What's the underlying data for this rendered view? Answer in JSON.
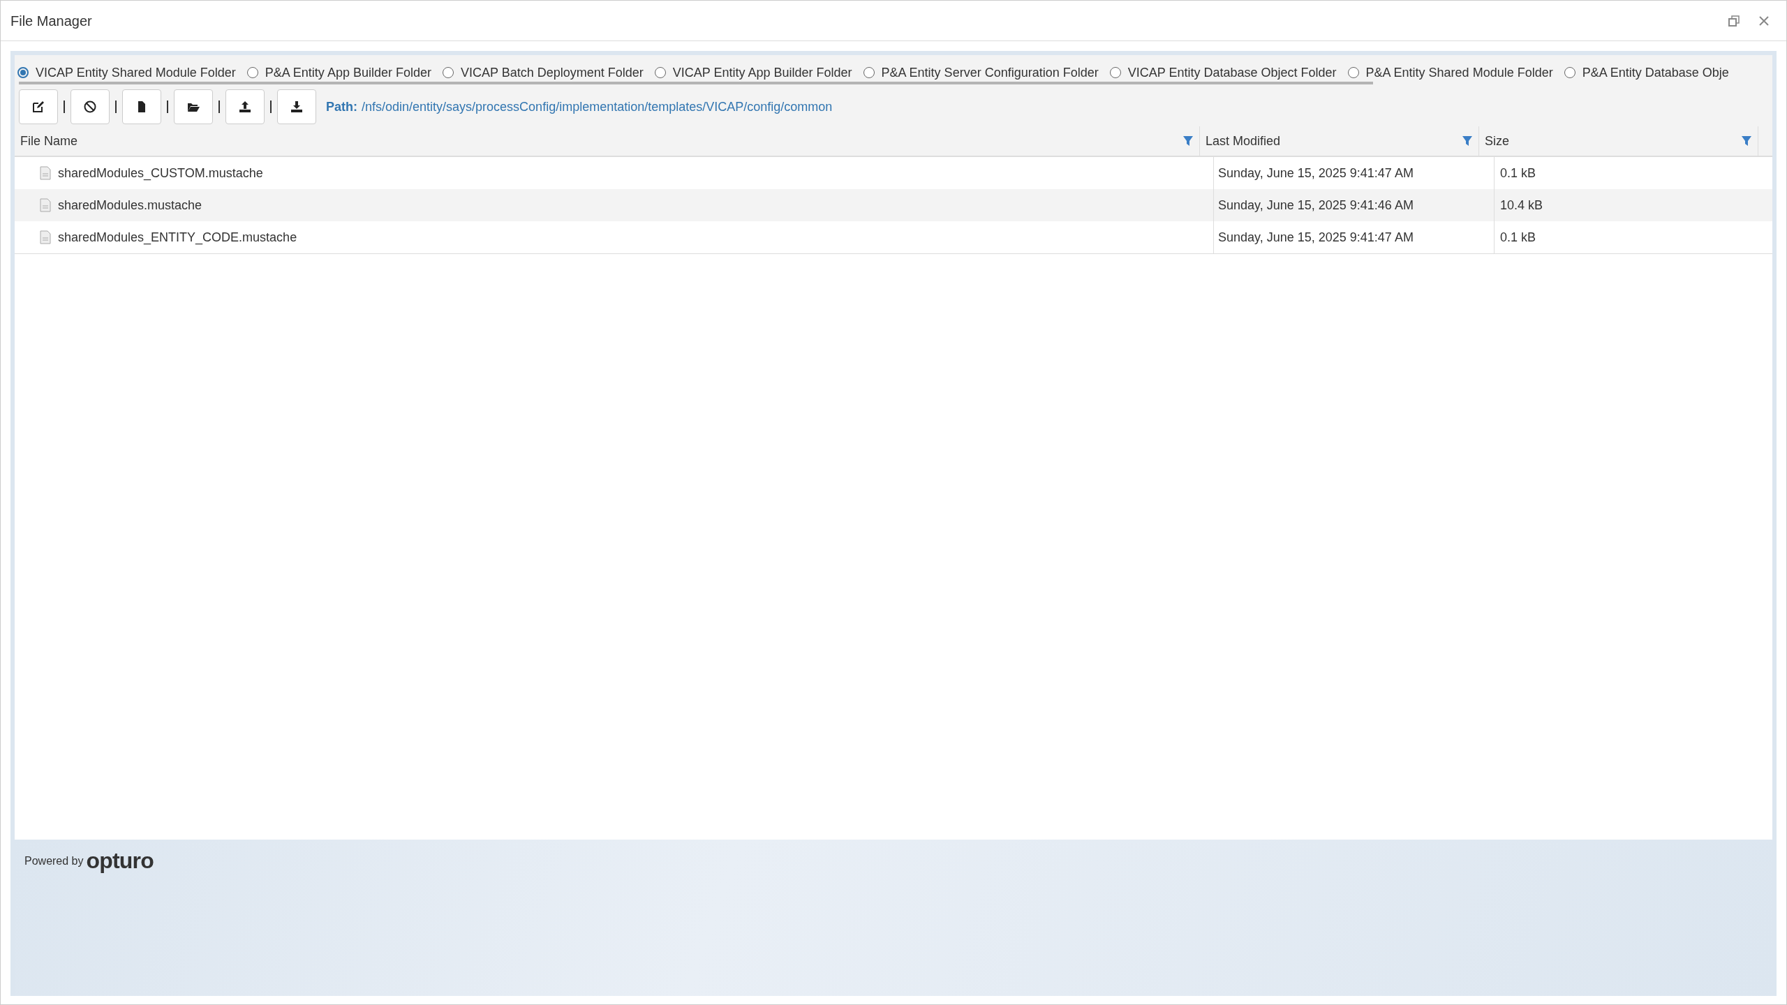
{
  "window": {
    "title": "File Manager"
  },
  "folders": [
    {
      "label": "VICAP Entity Shared Module Folder",
      "selected": true
    },
    {
      "label": "P&A Entity App Builder Folder",
      "selected": false
    },
    {
      "label": "VICAP Batch Deployment Folder",
      "selected": false
    },
    {
      "label": "VICAP Entity App Builder Folder",
      "selected": false
    },
    {
      "label": "P&A Entity Server Configuration Folder",
      "selected": false
    },
    {
      "label": "VICAP Entity Database Object Folder",
      "selected": false
    },
    {
      "label": "P&A Entity Shared Module Folder",
      "selected": false
    },
    {
      "label": "P&A Entity Database Obje",
      "selected": false
    }
  ],
  "toolbar": {
    "buttons": [
      {
        "kind": "edit"
      },
      {
        "kind": "block"
      },
      {
        "kind": "file"
      },
      {
        "kind": "folder"
      },
      {
        "kind": "upload"
      },
      {
        "kind": "download"
      }
    ],
    "path_label": "Path:",
    "path": "/nfs/odin/entity/says/processConfig/implementation/templates/VICAP/config/common"
  },
  "table": {
    "columns": [
      "File Name",
      "Last Modified",
      "Size"
    ],
    "rows": [
      {
        "name": "sharedModules_CUSTOM.mustache",
        "modified": "Sunday, June 15, 2025 9:41:47 AM",
        "size": "0.1 kB"
      },
      {
        "name": "sharedModules.mustache",
        "modified": "Sunday, June 15, 2025 9:41:46 AM",
        "size": "10.4 kB"
      },
      {
        "name": "sharedModules_ENTITY_CODE.mustache",
        "modified": "Sunday, June 15, 2025 9:41:47 AM",
        "size": "0.1 kB"
      }
    ]
  },
  "footer": {
    "powered_by": "Powered by",
    "brand": "opturo"
  }
}
